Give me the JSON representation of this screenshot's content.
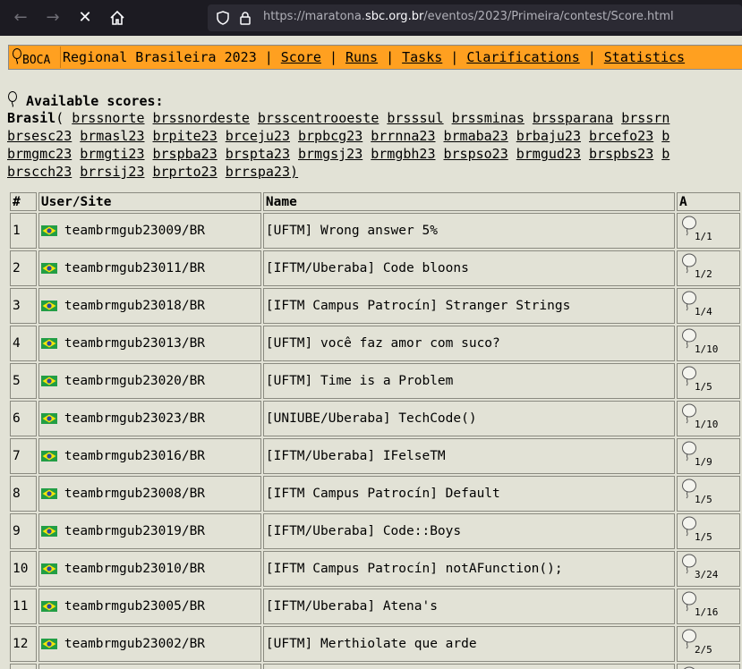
{
  "browser": {
    "url_prefix": "https://maratona.",
    "url_domain": "sbc.org.br",
    "url_path": "/eventos/2023/Primeira/contest/Score.html"
  },
  "menu": {
    "logo": "BOCA",
    "title": "Regional Brasileira 2023",
    "items": [
      "Score",
      "Runs",
      "Tasks",
      "Clarifications",
      "Statistics"
    ],
    "separator": "|"
  },
  "scores": {
    "heading": "Available scores:",
    "lead": "Brasil",
    "open_paren": "(",
    "close_paren": ")",
    "lines": [
      [
        "brssnorte",
        "brssnordeste",
        "brsscentrooeste",
        "brsssul",
        "brssminas",
        "brssparana",
        "brssrn"
      ],
      [
        "brsesc23",
        "brmasl23",
        "brpite23",
        "brceju23",
        "brpbcg23",
        "brrnna23",
        "brmaba23",
        "brbaju23",
        "brcefo23",
        "b"
      ],
      [
        "brmgmc23",
        "brmgti23",
        "brspba23",
        "brspta23",
        "brmgsj23",
        "brmgbh23",
        "brspso23",
        "brmgud23",
        "brspbs23",
        "b"
      ],
      [
        "brscch23",
        "brrsij23",
        "brprto23",
        "brrspa23"
      ]
    ]
  },
  "table": {
    "headers": [
      "#",
      "User/Site",
      "Name",
      "A"
    ],
    "rows": [
      {
        "rank": "1",
        "user": "teambrmgub23009/BR",
        "name": "[UFTM] Wrong answer 5%",
        "a": "1/1"
      },
      {
        "rank": "2",
        "user": "teambrmgub23011/BR",
        "name": "[IFTM/Uberaba] Code bloons",
        "a": "1/2"
      },
      {
        "rank": "3",
        "user": "teambrmgub23018/BR",
        "name": "[IFTM Campus Patrocín] Stranger Strings",
        "a": "1/4"
      },
      {
        "rank": "4",
        "user": "teambrmgub23013/BR",
        "name": "[UFTM] você faz amor com suco?",
        "a": "1/10"
      },
      {
        "rank": "5",
        "user": "teambrmgub23020/BR",
        "name": "[UFTM] Time is a Problem",
        "a": "1/5"
      },
      {
        "rank": "6",
        "user": "teambrmgub23023/BR",
        "name": "[UNIUBE/Uberaba] TechCode()",
        "a": "1/10"
      },
      {
        "rank": "7",
        "user": "teambrmgub23016/BR",
        "name": "[IFTM/Uberaba] IFelseTM",
        "a": "1/9"
      },
      {
        "rank": "8",
        "user": "teambrmgub23008/BR",
        "name": "[IFTM Campus Patrocín] Default",
        "a": "1/5"
      },
      {
        "rank": "9",
        "user": "teambrmgub23019/BR",
        "name": "[IFTM/Uberaba] Code::Boys",
        "a": "1/5"
      },
      {
        "rank": "10",
        "user": "teambrmgub23010/BR",
        "name": "[IFTM Campus Patrocín] notAFunction();",
        "a": "3/24"
      },
      {
        "rank": "11",
        "user": "teambrmgub23005/BR",
        "name": "[IFTM/Uberaba] Atena's",
        "a": "1/16"
      },
      {
        "rank": "12",
        "user": "teambrmgub23002/BR",
        "name": "[UFTM] Merthiolate que arde",
        "a": "2/5"
      },
      {
        "rank": "",
        "user": "",
        "name": "",
        "a": ""
      }
    ]
  }
}
